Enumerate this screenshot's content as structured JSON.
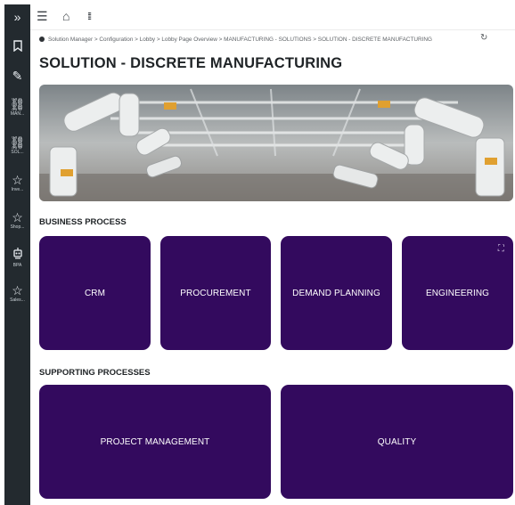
{
  "sidebar": {
    "items": [
      {
        "icon": "double-chevron-right-icon",
        "glyph": "»",
        "label": ""
      },
      {
        "icon": "bookmark-icon",
        "glyph": "🔖",
        "label": ""
      },
      {
        "icon": "pencil-icon",
        "glyph": "✎",
        "label": ""
      },
      {
        "icon": "network-icon",
        "glyph": "⛓",
        "label": "MAN..."
      },
      {
        "icon": "network-icon",
        "glyph": "⛓",
        "label": "SOL..."
      },
      {
        "icon": "star-icon",
        "glyph": "☆",
        "label": "Inve..."
      },
      {
        "icon": "star-icon",
        "glyph": "☆",
        "label": "Shop..."
      },
      {
        "icon": "robot-icon",
        "glyph": "🤖",
        "label": "BPA"
      },
      {
        "icon": "star-icon",
        "glyph": "☆",
        "label": "Sales..."
      }
    ]
  },
  "topbar": {
    "menu_glyph": "☰",
    "home_glyph": "⌂",
    "apps_glyph": "⁞⁞⁞"
  },
  "breadcrumb": "Solution Manager > Configuration > Lobby > Lobby Page Overview > MANUFACTURING - SOLUTIONS > SOLUTION - DISCRETE MANUFACTURING",
  "refresh_glyph": "↻",
  "page_title": "SOLUTION - DISCRETE MANUFACTURING",
  "sections": {
    "business_process": {
      "title": "BUSINESS PROCESS",
      "tiles": [
        "CRM",
        "PROCUREMENT",
        "DEMAND PLANNING",
        "ENGINEERING"
      ]
    },
    "supporting_processes": {
      "title": "SUPPORTING PROCESSES",
      "tiles": [
        "PROJECT MANAGEMENT",
        "QUALITY"
      ]
    }
  },
  "expand_glyph": "⛶",
  "colors": {
    "tile": "#330a5e",
    "rail": "#232a2f"
  }
}
